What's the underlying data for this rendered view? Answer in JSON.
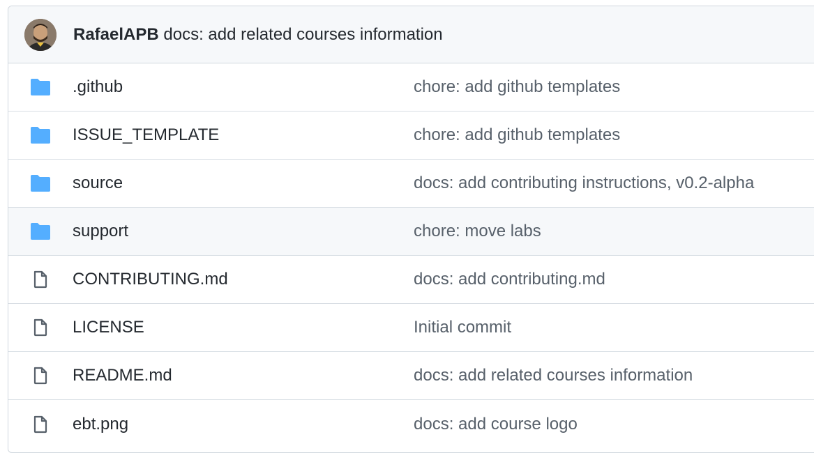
{
  "latest_commit": {
    "author": "RafaelAPB",
    "message": "docs: add related courses information"
  },
  "colors": {
    "folder": "#54aeff",
    "file_icon": "#57606a",
    "header_bg": "#f6f8fa",
    "border": "#d0d7de"
  },
  "files": [
    {
      "type": "folder",
      "icon": "folder-icon",
      "name": ".github",
      "commit": "chore: add github templates"
    },
    {
      "type": "folder",
      "icon": "folder-icon",
      "name": "ISSUE_TEMPLATE",
      "commit": "chore: add github templates"
    },
    {
      "type": "folder",
      "icon": "folder-icon",
      "name": "source",
      "commit": "docs: add contributing instructions, v0.2-alpha"
    },
    {
      "type": "folder",
      "icon": "folder-icon",
      "name": "support",
      "commit": "chore: move labs"
    },
    {
      "type": "file",
      "icon": "file-icon",
      "name": "CONTRIBUTING.md",
      "commit": "docs: add contributing.md"
    },
    {
      "type": "file",
      "icon": "file-icon",
      "name": "LICENSE",
      "commit": "Initial commit"
    },
    {
      "type": "file",
      "icon": "file-icon",
      "name": "README.md",
      "commit": "docs: add related courses information"
    },
    {
      "type": "file",
      "icon": "file-icon",
      "name": "ebt.png",
      "commit": "docs: add course logo"
    }
  ]
}
